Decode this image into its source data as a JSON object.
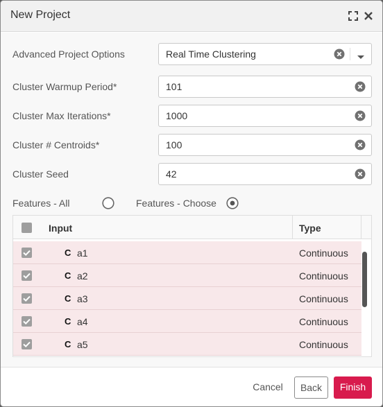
{
  "dialog": {
    "title": "New Project"
  },
  "form": {
    "advanced": {
      "label": "Advanced Project Options",
      "value": "Real Time Clustering"
    },
    "warmup": {
      "label": "Cluster Warmup Period*",
      "value": "101"
    },
    "max_iter": {
      "label": "Cluster Max Iterations*",
      "value": "1000"
    },
    "centroids": {
      "label": "Cluster # Centroids*",
      "value": "100"
    },
    "seed": {
      "label": "Cluster Seed",
      "value": "42"
    }
  },
  "features": {
    "all_label": "Features - All",
    "choose_label": "Features - Choose",
    "selected": "choose"
  },
  "grid": {
    "columns": [
      "Input",
      "Type"
    ],
    "rows": [
      {
        "badge": "C",
        "name": "a1",
        "type": "Continuous",
        "checked": true
      },
      {
        "badge": "C",
        "name": "a2",
        "type": "Continuous",
        "checked": true
      },
      {
        "badge": "C",
        "name": "a3",
        "type": "Continuous",
        "checked": true
      },
      {
        "badge": "C",
        "name": "a4",
        "type": "Continuous",
        "checked": true
      },
      {
        "badge": "C",
        "name": "a5",
        "type": "Continuous",
        "checked": true
      }
    ]
  },
  "footer": {
    "cancel": "Cancel",
    "back": "Back",
    "finish": "Finish"
  },
  "colors": {
    "accent": "#d81b4d",
    "row_highlight": "#f8e8ea",
    "checkbox": "#9e9e9e"
  }
}
